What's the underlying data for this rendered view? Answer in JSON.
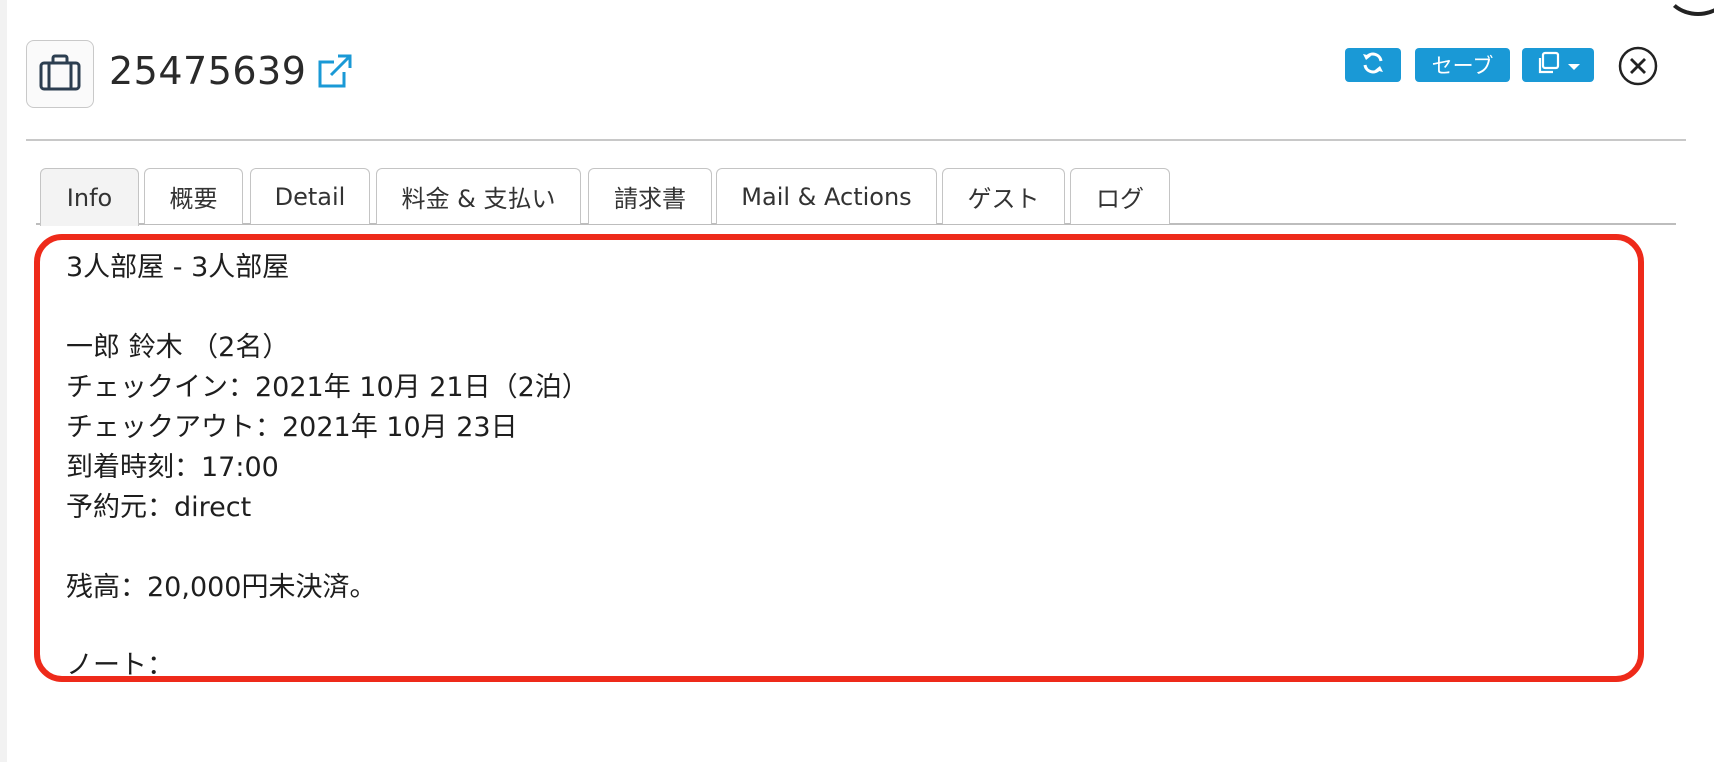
{
  "header": {
    "booking_id": "25475639",
    "icons": {
      "booking": "briefcase-icon",
      "open_link": "external-link-icon",
      "refresh": "refresh-icon",
      "copy": "copy-icon",
      "dropdown": "caret-down-icon",
      "close": "close-circle-icon"
    }
  },
  "toolbar": {
    "save_label": "セーブ"
  },
  "tabs": [
    {
      "label": "Info",
      "active": true
    },
    {
      "label": "概要",
      "active": false
    },
    {
      "label": "Detail",
      "active": false
    },
    {
      "label": "料金 & 支払い",
      "active": false
    },
    {
      "label": "請求書",
      "active": false
    },
    {
      "label": "Mail & Actions",
      "active": false
    },
    {
      "label": "ゲスト",
      "active": false
    },
    {
      "label": "ログ",
      "active": false
    }
  ],
  "info": {
    "room": "3人部屋 - 3人部屋",
    "guest": "一郎 鈴木 （2名）",
    "check_in": "チェックイン：2021年 10月 21日（2泊）",
    "check_out": "チェックアウト：2021年 10月 23日",
    "arrival_time": "到着時刻：17:00",
    "source": "予約元：direct",
    "balance": "残高：20,000円未決済。",
    "note": "ノート："
  },
  "colors": {
    "accent": "#1a99d6",
    "highlight": "#ee2a1a",
    "text": "#222222"
  }
}
